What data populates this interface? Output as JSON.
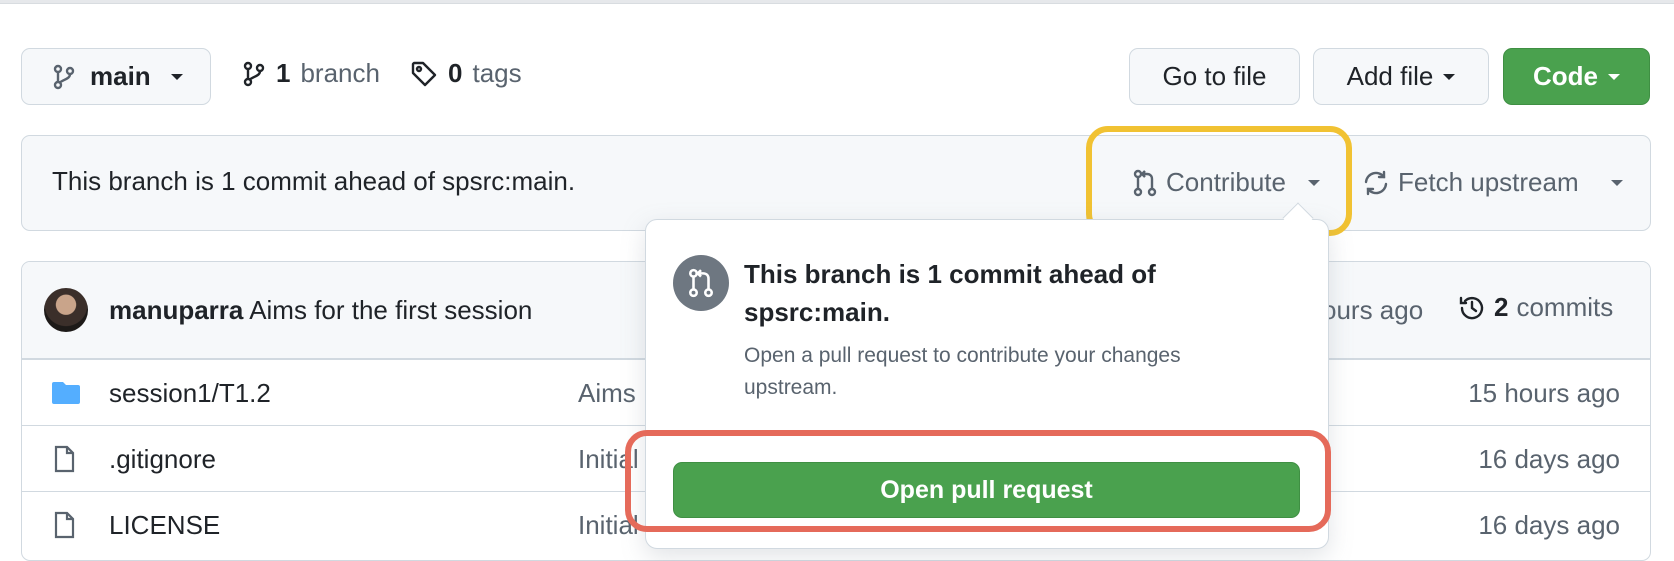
{
  "toolbar": {
    "branch_label": "main",
    "branch_count": "1",
    "branch_word": "branch",
    "tag_count": "0",
    "tag_word": "tags",
    "goto_label": "Go to file",
    "add_label": "Add file",
    "code_label": "Code"
  },
  "ahead": {
    "text": "This branch is 1 commit ahead of spsrc:main.",
    "contribute_label": "Contribute",
    "fetch_label": "Fetch upstream"
  },
  "commit": {
    "author": "manuparra",
    "message": "Aims for the first session",
    "time": "ours ago",
    "commit_count": "2",
    "commit_word": "commits"
  },
  "files": [
    {
      "name": "session1/T1.2",
      "message": "Aims",
      "time": "15 hours ago",
      "type": "folder"
    },
    {
      "name": ".gitignore",
      "message": "Initial",
      "time": "16 days ago",
      "type": "file"
    },
    {
      "name": "LICENSE",
      "message": "Initial",
      "time": "16 days ago",
      "type": "file"
    }
  ],
  "popover": {
    "title": "This branch is 1 commit ahead of spsrc:main.",
    "description": "Open a pull request to contribute your changes upstream.",
    "button_label": "Open pull request"
  },
  "colors": {
    "accent_green": "#4aa14e",
    "highlight_yellow": "#f1c232",
    "highlight_red": "#e56a5a",
    "folder_blue": "#54aeff"
  }
}
